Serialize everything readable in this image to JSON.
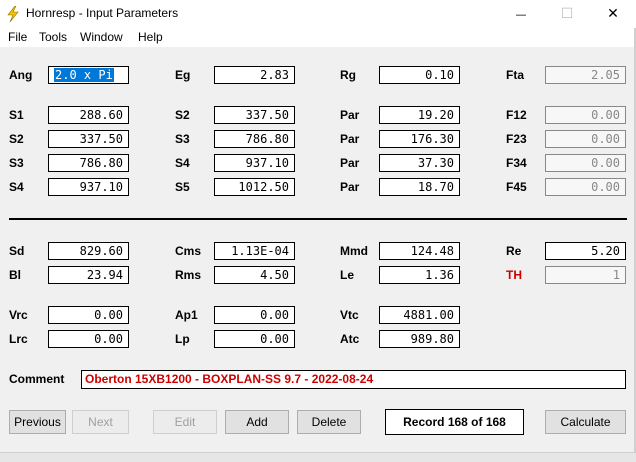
{
  "window": {
    "title": "Hornresp - Input Parameters",
    "minimize_glyph": "—",
    "maximize_glyph": "☐",
    "close_glyph": "✕",
    "icon": "lightning-bolt-icon",
    "accent_icon_color": "#f5c400"
  },
  "menu": {
    "file": "File",
    "tools": "Tools",
    "window": "Window",
    "help": "Help"
  },
  "params": {
    "ang": {
      "label": "Ang",
      "value": "2.0 x Pi"
    },
    "eg": {
      "label": "Eg",
      "value": "2.83"
    },
    "rg": {
      "label": "Rg",
      "value": "0.10"
    },
    "fta": {
      "label": "Fta",
      "value": "2.05"
    },
    "s1_left": {
      "label": "S1",
      "value": "288.60"
    },
    "s2_left": {
      "label": "S2",
      "value": "337.50"
    },
    "s3_left": {
      "label": "S3",
      "value": "786.80"
    },
    "s4_left": {
      "label": "S4",
      "value": "937.10"
    },
    "s2_mid": {
      "label": "S2",
      "value": "337.50"
    },
    "s3_mid": {
      "label": "S3",
      "value": "786.80"
    },
    "s4_mid": {
      "label": "S4",
      "value": "937.10"
    },
    "s5_mid": {
      "label": "S5",
      "value": "1012.50"
    },
    "par1": {
      "label": "Par",
      "value": "19.20"
    },
    "par2": {
      "label": "Par",
      "value": "176.30"
    },
    "par3": {
      "label": "Par",
      "value": "37.30"
    },
    "par4": {
      "label": "Par",
      "value": "18.70"
    },
    "f12": {
      "label": "F12",
      "value": "0.00"
    },
    "f23": {
      "label": "F23",
      "value": "0.00"
    },
    "f34": {
      "label": "F34",
      "value": "0.00"
    },
    "f45": {
      "label": "F45",
      "value": "0.00"
    },
    "sd": {
      "label": "Sd",
      "value": "829.60"
    },
    "bl": {
      "label": "Bl",
      "value": "23.94"
    },
    "cms": {
      "label": "Cms",
      "value": "1.13E-04"
    },
    "rms": {
      "label": "Rms",
      "value": "4.50"
    },
    "mmd": {
      "label": "Mmd",
      "value": "124.48"
    },
    "le": {
      "label": "Le",
      "value": "1.36"
    },
    "re": {
      "label": "Re",
      "value": "5.20"
    },
    "th": {
      "label": "TH",
      "value": "1"
    },
    "vrc": {
      "label": "Vrc",
      "value": "0.00"
    },
    "lrc": {
      "label": "Lrc",
      "value": "0.00"
    },
    "ap1": {
      "label": "Ap1",
      "value": "0.00"
    },
    "lp": {
      "label": "Lp",
      "value": "0.00"
    },
    "vtc": {
      "label": "Vtc",
      "value": "4881.00"
    },
    "atc": {
      "label": "Atc",
      "value": "989.80"
    }
  },
  "comment": {
    "label": "Comment",
    "value": "Oberton 15XB1200 - BOXPLAN-SS 9.7 - 2022-08-24"
  },
  "buttons": {
    "previous": "Previous",
    "next": "Next",
    "edit": "Edit",
    "add": "Add",
    "delete": "Delete",
    "calculate": "Calculate"
  },
  "record": "Record 168 of 168",
  "colors": {
    "label_red": "#cc0000",
    "selection": "#0078d7"
  }
}
